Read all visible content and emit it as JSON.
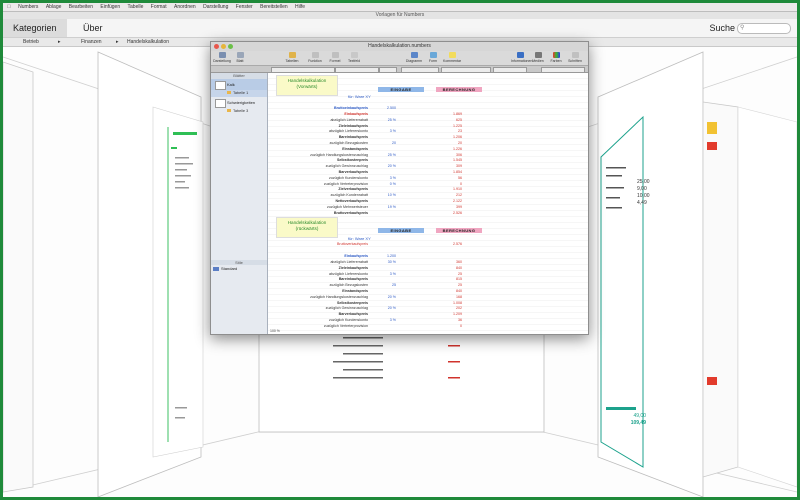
{
  "menubar": {
    "items": [
      "Numbers",
      "Ablage",
      "Bearbeiten",
      "Einfügen",
      "Tabelle",
      "Format",
      "Anordnen",
      "Darstellung",
      "Fenster",
      "Bereitstellen",
      "Hilfe"
    ]
  },
  "window_title": "Vorlagen für Numbers",
  "topbar": {
    "tab_categories": "Kategorien",
    "tab_about": "Über",
    "search_label": "Suche"
  },
  "breadcrumb": [
    "Betrieb",
    "Finanzen",
    "Handelskalkulation"
  ],
  "doc_window": {
    "title": "Handelskalkulation.numbers",
    "toolbar": [
      "Darstellung",
      "Blatt",
      "Tabellen",
      "Funktion",
      "Formel",
      "Textfeld",
      "Diagramm",
      "Form",
      "Kommentar",
      "Informationen",
      "Medien",
      "Farben",
      "Schriften"
    ],
    "sidebar": {
      "header": "Blätter",
      "sheet1": "Kalk",
      "sheet1_table": "Tabelle 1",
      "sheet2": "Schwierigkeiten",
      "sheet2_table": "Tabelle 3",
      "styles_header": "Stile",
      "style_item": "Standard"
    },
    "block1": {
      "title": "Handelskalkulation (Vorwärts)",
      "product": "für: Ware XY",
      "col_in": "EINGABE",
      "col_calc": "BERECHNUNG",
      "listprice_label": "Bruttoeinkaufspreis",
      "listprice_value": "2.500",
      "rows": [
        {
          "label": "Einkaufspreis",
          "pct": "",
          "val": "1.869"
        },
        {
          "label": "abzüglich Liefererrabatt",
          "pct": "25 %",
          "val": "625"
        },
        {
          "label": "Zieleinkaufspreis",
          "pct": "",
          "val": "1.225"
        },
        {
          "label": "abzüglich Liefererskonto",
          "pct": "3 %",
          "val": "23"
        },
        {
          "label": "Bareinkaufspreis",
          "pct": "",
          "val": "1.206"
        },
        {
          "label": "zuzüglich Bezugskosten",
          "pct": "20",
          "val": "20"
        },
        {
          "label": "Einstandspreis",
          "pct": "",
          "val": "1.226"
        },
        {
          "label": "zuzüglich Handlungskostenzuschlag",
          "pct": "25 %",
          "val": "306"
        },
        {
          "label": "Selbstkostenpreis",
          "pct": "",
          "val": "1.545"
        },
        {
          "label": "zuzüglich Gewinnzuschlag",
          "pct": "20 %",
          "val": "309"
        },
        {
          "label": "Barverkaufspreis",
          "pct": "",
          "val": "1.854"
        },
        {
          "label": "zuzüglich Kundenskonto",
          "pct": "3 %",
          "val": "56"
        },
        {
          "label": "zuzüglich Vertreterprovision",
          "pct": "0 %",
          "val": "0"
        },
        {
          "label": "Zielverkaufspreis",
          "pct": "",
          "val": "1.910"
        },
        {
          "label": "zuzüglich Kundenrabatt",
          "pct": "10 %",
          "val": "212"
        },
        {
          "label": "Nettoverkaufspreis",
          "pct": "",
          "val": "2.122"
        },
        {
          "label": "zuzüglich Mehrwertsteuer",
          "pct": "19 %",
          "val": "399"
        },
        {
          "label": "Bruttoverkaufspreis",
          "pct": "",
          "val": "2.526"
        }
      ]
    },
    "block2": {
      "title": "Handelskalkulation (rückwärts)",
      "product": "für: Ware XY",
      "col_in": "EINGABE",
      "col_calc": "BERECHNUNG",
      "top_label": "Bruttoverkaufspreis",
      "top_value": "2.576",
      "listprice_label": "Einkaufspreis",
      "listprice_value": "1.200",
      "rows": [
        {
          "label": "abzüglich Liefererrabatt",
          "pct": "30 %",
          "val": "360"
        },
        {
          "label": "Zieleinkaufspreis",
          "pct": "",
          "val": "840"
        },
        {
          "label": "abzüglich Liefererskonto",
          "pct": "3 %",
          "val": "25"
        },
        {
          "label": "Bareinkaufspreis",
          "pct": "",
          "val": "815"
        },
        {
          "label": "zuzüglich Bezugskosten",
          "pct": "25",
          "val": "25"
        },
        {
          "label": "Einstandspreis",
          "pct": "",
          "val": "840"
        },
        {
          "label": "zuzüglich Handlungskostenzuschlag",
          "pct": "20 %",
          "val": "168"
        },
        {
          "label": "Selbstkostenpreis",
          "pct": "",
          "val": "1.008"
        },
        {
          "label": "zuzüglich Gewinnzuschlag",
          "pct": "20 %",
          "val": "202"
        },
        {
          "label": "Barverkaufspreis",
          "pct": "",
          "val": "1.209"
        },
        {
          "label": "zuzüglich Kundenskonto",
          "pct": "3 %",
          "val": "36"
        },
        {
          "label": "zuzüglich Vertreterprovision",
          "pct": "",
          "val": "0"
        }
      ]
    },
    "zoom": "100 %"
  },
  "right_card": {
    "values": [
      "25,00",
      "9,00",
      "10,00",
      "4,49"
    ],
    "footer_values": [
      "49,00",
      "109,49"
    ]
  },
  "colors": {
    "frame": "#1f8a3a",
    "chip_in": "#8fb7e8",
    "chip_calc": "#f0a6c1",
    "title_green": "#2a8a2a",
    "red": "#d0332c",
    "blue": "#2a58c4"
  }
}
